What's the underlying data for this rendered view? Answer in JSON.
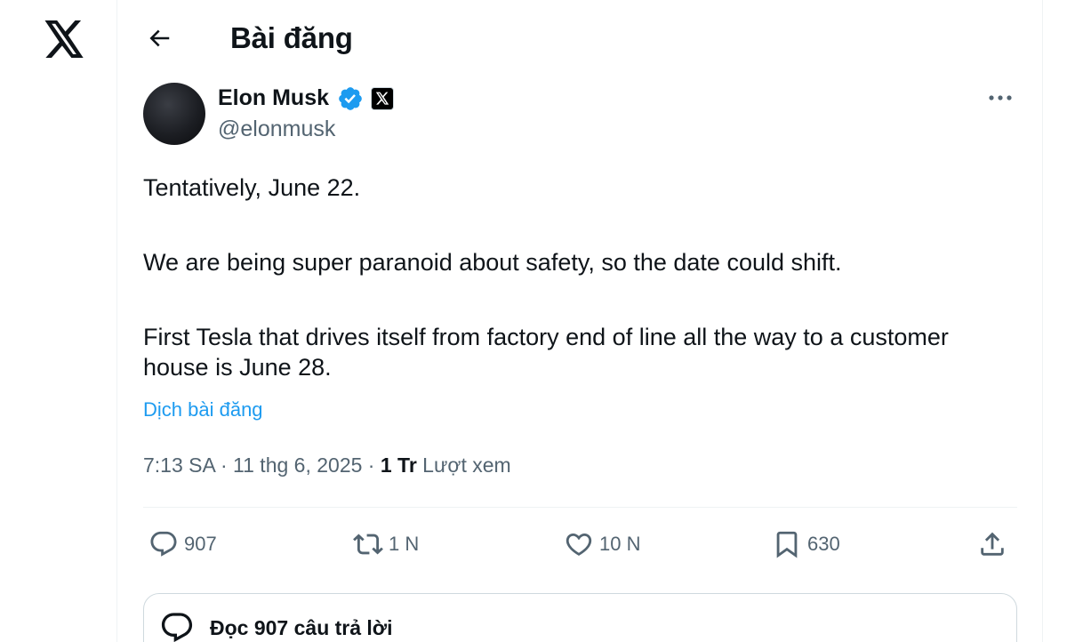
{
  "header": {
    "title": "Bài đăng"
  },
  "author": {
    "name": "Elon Musk",
    "handle": "@elonmusk",
    "verified": true
  },
  "tweet": {
    "paragraphs": [
      "Tentatively, June 22.",
      "We are being super paranoid about safety, so the date could shift.",
      "First Tesla that drives itself from factory end of line all the way to a customer house is June 28."
    ],
    "translate_label": "Dịch bài đăng"
  },
  "meta": {
    "time": "7:13 SA",
    "date": "11 thg 6, 2025",
    "views_count": "1 Tr",
    "views_label": "Lượt xem"
  },
  "actions": {
    "replies": "907",
    "reposts": "1 N",
    "likes": "10 N",
    "bookmarks": "630"
  },
  "read_replies": {
    "label": "Đọc 907 câu trả lời"
  },
  "icons": {
    "logo": "x-logo-icon",
    "back": "arrow-left-icon",
    "verified": "verified-badge-icon",
    "more": "more-horizontal-icon",
    "reply": "reply-icon",
    "repost": "repost-icon",
    "like": "heart-icon",
    "bookmark": "bookmark-icon",
    "share": "share-icon"
  },
  "colors": {
    "accent": "#1d9bf0",
    "text_primary": "#0f1419",
    "text_secondary": "#536471",
    "border": "#eff3f4"
  }
}
